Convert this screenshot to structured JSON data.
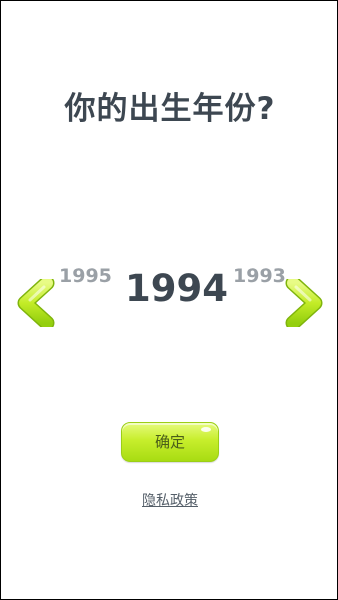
{
  "title": "你的出生年份?",
  "year_picker": {
    "previous": "1995",
    "current": "1994",
    "next": "1993"
  },
  "confirm_button": {
    "label": "确定"
  },
  "privacy_link": {
    "label": "隐私政策"
  },
  "colors": {
    "accent_green": "#a8dc12",
    "title_text": "#3d4751",
    "muted_text": "#9aa0a6"
  },
  "icons": {
    "left": "chevron-left-icon",
    "right": "chevron-right-icon"
  }
}
